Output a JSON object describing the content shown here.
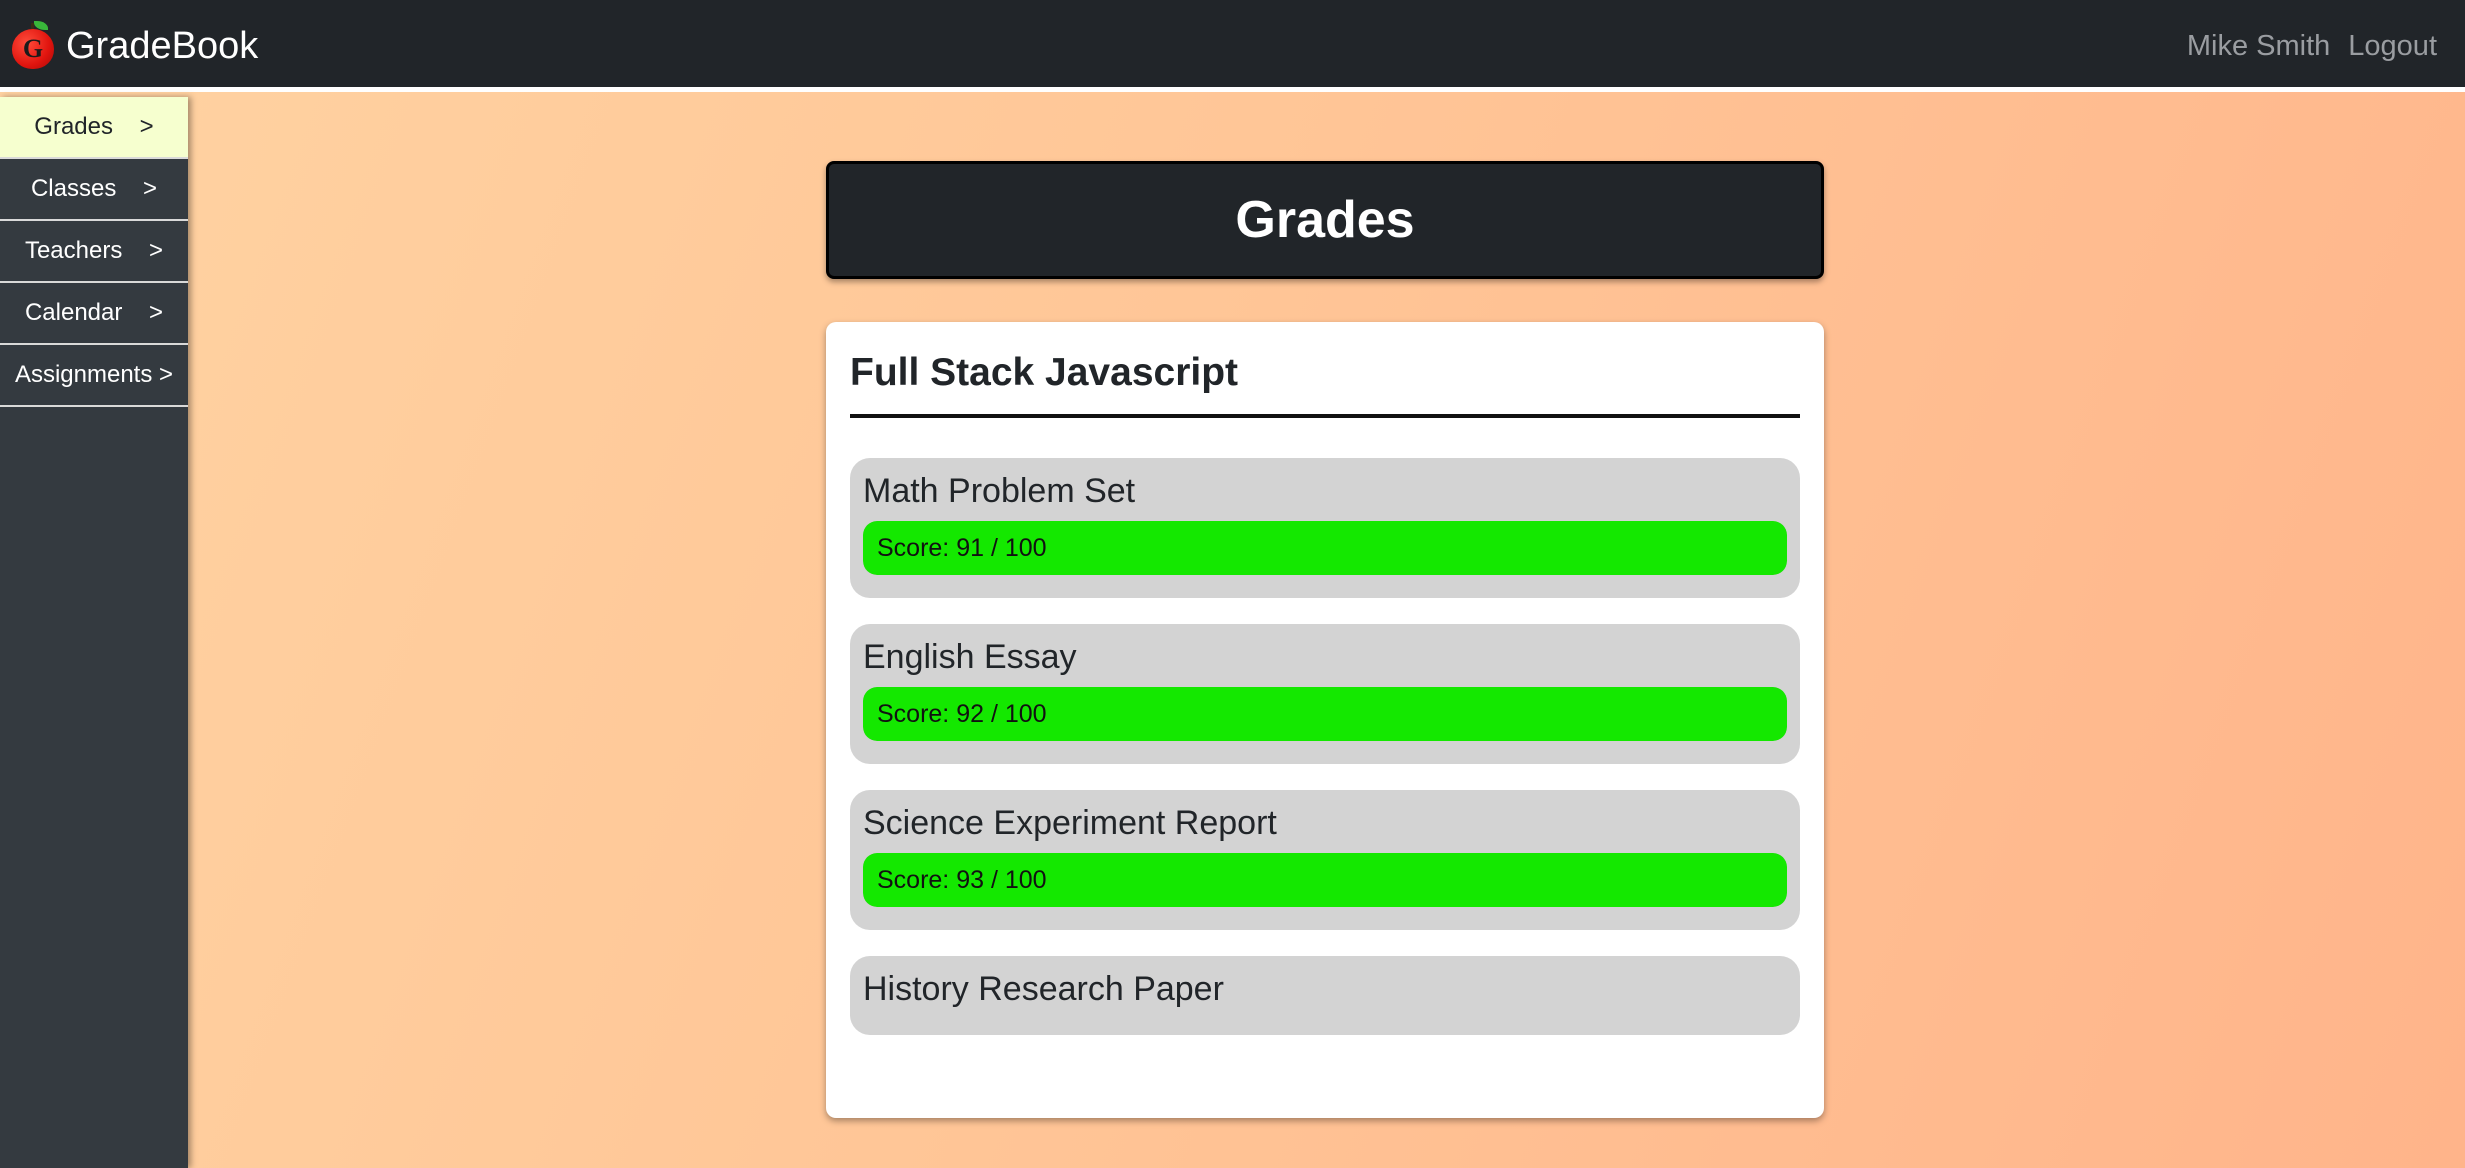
{
  "header": {
    "brand": "GradeBook",
    "logo_letter": "G",
    "user_name": "Mike Smith",
    "logout_label": "Logout"
  },
  "sidebar": {
    "items": [
      {
        "label": "Grades    >",
        "active": true
      },
      {
        "label": "Classes    >",
        "active": false
      },
      {
        "label": "Teachers    >",
        "active": false
      },
      {
        "label": "Calendar    >",
        "active": false
      },
      {
        "label": "Assignments >",
        "active": false
      }
    ]
  },
  "main": {
    "title": "Grades",
    "course": {
      "name": "Full Stack Javascript",
      "assignments": [
        {
          "name": "Math Problem Set",
          "score_text": "Score: 91 / 100",
          "score": 91,
          "max": 100
        },
        {
          "name": "English Essay",
          "score_text": "Score: 92 / 100",
          "score": 92,
          "max": 100
        },
        {
          "name": "Science Experiment Report",
          "score_text": "Score: 93 / 100",
          "score": 93,
          "max": 100
        },
        {
          "name": "History Research Paper"
        }
      ]
    }
  },
  "colors": {
    "navbar": "#212529",
    "sidebar": "#343a40",
    "sidebar_active": "#f6ffcf",
    "score_fill": "#14e800",
    "assignment_bg": "#d3d3d3"
  }
}
